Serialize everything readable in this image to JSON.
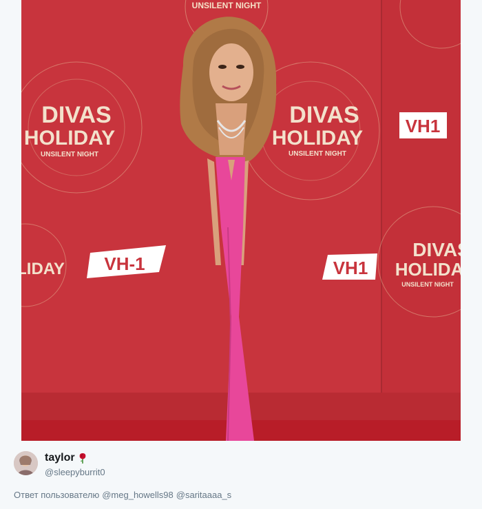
{
  "photo": {
    "signage": {
      "top_banner": "UNSILENT NIGHT",
      "logo_line1": "DIVAS",
      "logo_line2": "HOLIDAY",
      "logo_sub": "UNSILENT NIGHT",
      "network_logo": "VH1",
      "network_logo_alt": "VH-1"
    },
    "colors": {
      "backdrop_red": "#c8343d",
      "carpet_red": "#b81d28",
      "dress_pink": "#e8479a",
      "logo_gold": "#e8c7a0"
    }
  },
  "tweet": {
    "display_name": "taylor",
    "name_emoji_icon": "rose-icon",
    "handle": "@sleepyburrit0",
    "reply_prefix": "Ответ пользователю",
    "reply_mentions": [
      "@meg_howells98",
      "@saritaaaa_s"
    ]
  }
}
